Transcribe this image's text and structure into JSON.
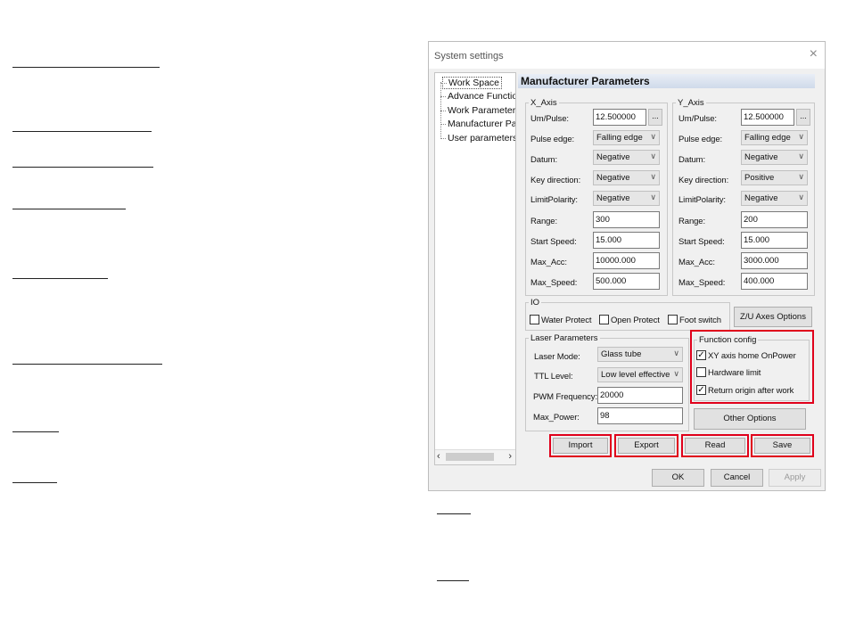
{
  "window": {
    "title": "System settings",
    "close_glyph": "×"
  },
  "tree": {
    "items": [
      "Work Space",
      "Advance Functions",
      "Work Parameters",
      "Manufacturer Para",
      "User parameters"
    ],
    "scroll_left": "‹",
    "scroll_right": "›"
  },
  "panel": {
    "heading": "Manufacturer Parameters"
  },
  "x_axis": {
    "legend": "X_Axis",
    "labels": [
      "Um/Pulse:",
      "Pulse edge:",
      "Datum:",
      "Key direction:",
      "LimitPolarity:",
      "Range:",
      "Start Speed:",
      "Max_Acc:",
      "Max_Speed:"
    ],
    "um_pulse": "12.500000",
    "pulse_edge": "Falling edge",
    "datum": "Negative",
    "key_direction": "Negative",
    "limit_polarity": "Negative",
    "range": "300",
    "start_speed": "15.000",
    "max_acc": "10000.000",
    "max_speed": "500.000"
  },
  "y_axis": {
    "legend": "Y_Axis",
    "labels": [
      "Um/Pulse:",
      "Pulse edge:",
      "Datum:",
      "Key direction:",
      "LimitPolarity:",
      "Range:",
      "Start Speed:",
      "Max_Acc:",
      "Max_Speed:"
    ],
    "um_pulse": "12.500000",
    "pulse_edge": "Falling edge",
    "datum": "Negative",
    "key_direction": "Positive",
    "limit_polarity": "Negative",
    "range": "200",
    "start_speed": "15.000",
    "max_acc": "3000.000",
    "max_speed": "400.000"
  },
  "dots_label": "...",
  "io": {
    "legend": "IO",
    "water_protect": "Water Protect",
    "open_protect": "Open Protect",
    "foot_switch": "Foot switch"
  },
  "zu_button": "Z/U Axes Options",
  "laser": {
    "legend": "Laser Parameters",
    "mode_label": "Laser Mode:",
    "mode_value": "Glass tube",
    "ttl_label": "TTL Level:",
    "ttl_value": "Low level effective",
    "pwm_label": "PWM Frequency:",
    "pwm_value": "20000",
    "power_label": "Max_Power:",
    "power_value": "98"
  },
  "function_config": {
    "legend": "Function config",
    "xy_home": "XY axis home OnPower",
    "xy_home_checked": "✓",
    "hardware_limit": "Hardware limit",
    "return_origin": "Return origin after work",
    "return_origin_checked": "✓"
  },
  "other_options": "Other Options",
  "actions": {
    "import": "Import",
    "export": "Export",
    "read": "Read",
    "save": "Save"
  },
  "footer": {
    "ok": "OK",
    "cancel": "Cancel",
    "apply": "Apply"
  },
  "colors": {
    "highlight": "#e0001b"
  }
}
